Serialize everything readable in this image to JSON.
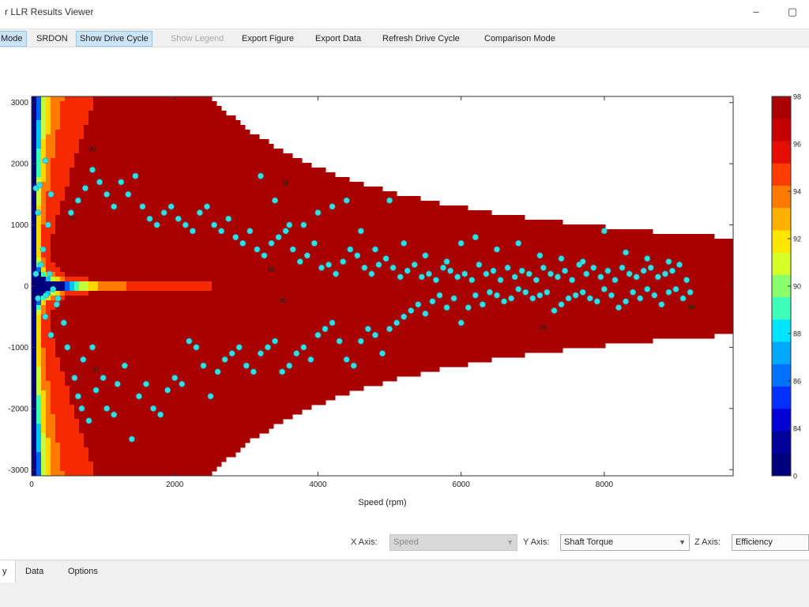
{
  "window": {
    "title": "r LLR Results Viewer",
    "minimize_glyph": "–",
    "close_glyph": "▢"
  },
  "toolbar": {
    "items": [
      {
        "label": "Mode",
        "state": "active"
      },
      {
        "label": "SRDON",
        "state": "normal"
      },
      {
        "label": "Show Drive Cycle",
        "state": "active"
      },
      {
        "label": "Show Legend",
        "state": "disabled"
      },
      {
        "label": "Export Figure",
        "state": "normal"
      },
      {
        "label": "Export Data",
        "state": "normal"
      },
      {
        "label": "Refresh Drive Cycle",
        "state": "normal"
      },
      {
        "label": "Comparison Mode",
        "state": "normal"
      }
    ]
  },
  "axis_selectors": {
    "x": {
      "label": "X Axis:",
      "value": "Speed",
      "enabled": false
    },
    "y": {
      "label": "Y Axis:",
      "value": "Shaft Torque",
      "enabled": true
    },
    "z": {
      "label": "Z Axis:",
      "value": "Efficiency",
      "enabled": true
    },
    "arrow_glyph": "▼"
  },
  "tabs": [
    {
      "label": "y",
      "active": true
    },
    {
      "label": "Data",
      "active": false
    },
    {
      "label": "Options",
      "active": false
    }
  ],
  "colors": {
    "out_of_envelope": "#ffffff",
    "contour_line": "#5a2a00",
    "scatter": "#2fe0e6",
    "scatter_edge": "#18a5b0"
  },
  "chart_data": {
    "type": "contour",
    "xlabel": "Speed (rpm)",
    "ylabel": "",
    "xlim": [
      0,
      9800
    ],
    "ylim": [
      -3100,
      3100
    ],
    "xticks": [
      0,
      2000,
      4000,
      6000,
      8000
    ],
    "yticks": [
      -3000,
      -2000,
      -1000,
      0,
      1000,
      2000,
      3000
    ],
    "xtick_labels": [
      "0",
      "2000",
      "4000",
      "6000",
      "8000"
    ],
    "ytick_labels": [
      "-3000",
      "-2000",
      "-1000",
      "0",
      "1000",
      "2000",
      "3000"
    ],
    "grid": false,
    "envelope": {
      "base_speed": 2500,
      "peak": 3100,
      "power_constant": 7750000,
      "min_limit": 700
    },
    "contour_levels": [
      0,
      84,
      86,
      88,
      90,
      92,
      94,
      96,
      98
    ],
    "contour_colors": [
      "#00007f",
      "#0000d8",
      "#005eff",
      "#00c2ff",
      "#3dffba",
      "#c2ff3d",
      "#ffd700",
      "#ff7b00",
      "#f52a00",
      "#a80000"
    ],
    "colorbar": {
      "levels": [
        "98",
        "96",
        "94",
        "92",
        "90",
        "88",
        "86",
        "84",
        "0"
      ],
      "colors": [
        "#a80000",
        "#c40000",
        "#e50d00",
        "#ff3b00",
        "#ff7b00",
        "#ffb000",
        "#ffe600",
        "#d6ff29",
        "#8aff6d",
        "#3dffba",
        "#00e5ff",
        "#00a8ff",
        "#0070ff",
        "#0030ff",
        "#0000d4",
        "#00009a",
        "#00007f"
      ]
    },
    "contour_labels": [
      {
        "text": "90",
        "x": 850,
        "y": 2200
      },
      {
        "text": "94",
        "x": 580,
        "y": 1070
      },
      {
        "text": "98",
        "x": 3550,
        "y": 1650
      },
      {
        "text": "96",
        "x": 3350,
        "y": 230
      },
      {
        "text": "96",
        "x": 3500,
        "y": -270
      },
      {
        "text": "92",
        "x": 900,
        "y": -1400
      },
      {
        "text": "98",
        "x": 7150,
        "y": -710
      },
      {
        "text": "96",
        "x": 9220,
        "y": -380
      }
    ],
    "drive_cycle": {
      "name": "Drive Cycle",
      "points": [
        [
          60,
          1600
        ],
        [
          110,
          1650
        ],
        [
          190,
          2050
        ],
        [
          270,
          1500
        ],
        [
          230,
          1000
        ],
        [
          90,
          1200
        ],
        [
          160,
          600
        ],
        [
          60,
          200
        ],
        [
          130,
          350
        ],
        [
          250,
          200
        ],
        [
          200,
          -150
        ],
        [
          90,
          -200
        ],
        [
          300,
          -50
        ],
        [
          350,
          -300
        ],
        [
          190,
          -500
        ],
        [
          270,
          -800
        ],
        [
          370,
          -200
        ],
        [
          450,
          -600
        ],
        [
          500,
          -1000
        ],
        [
          600,
          -1500
        ],
        [
          650,
          -1800
        ],
        [
          700,
          -2000
        ],
        [
          800,
          -2200
        ],
        [
          720,
          -1200
        ],
        [
          850,
          -1000
        ],
        [
          900,
          -1700
        ],
        [
          1000,
          -1500
        ],
        [
          1050,
          -2000
        ],
        [
          1150,
          -2100
        ],
        [
          1200,
          -1600
        ],
        [
          1300,
          -1300
        ],
        [
          1400,
          -2500
        ],
        [
          1500,
          -1800
        ],
        [
          1600,
          -1600
        ],
        [
          1700,
          -2000
        ],
        [
          1800,
          -2100
        ],
        [
          1900,
          -1700
        ],
        [
          2000,
          -1500
        ],
        [
          2100,
          -1600
        ],
        [
          2200,
          -900
        ],
        [
          2300,
          -1000
        ],
        [
          2400,
          -1300
        ],
        [
          2500,
          -1800
        ],
        [
          2600,
          -1400
        ],
        [
          2700,
          -1200
        ],
        [
          2800,
          -1100
        ],
        [
          2900,
          -1000
        ],
        [
          3000,
          -1300
        ],
        [
          3100,
          -1400
        ],
        [
          3200,
          -1100
        ],
        [
          3300,
          -1000
        ],
        [
          3400,
          -900
        ],
        [
          3500,
          -1400
        ],
        [
          3600,
          -1300
        ],
        [
          3700,
          -1100
        ],
        [
          3800,
          -1000
        ],
        [
          3900,
          -1200
        ],
        [
          4000,
          -800
        ],
        [
          4100,
          -700
        ],
        [
          4200,
          -600
        ],
        [
          4300,
          -900
        ],
        [
          4400,
          -1200
        ],
        [
          4500,
          -1300
        ],
        [
          4600,
          -900
        ],
        [
          4700,
          -700
        ],
        [
          4800,
          -800
        ],
        [
          4900,
          -1100
        ],
        [
          5000,
          -700
        ],
        [
          5100,
          -600
        ],
        [
          5200,
          -500
        ],
        [
          5300,
          -400
        ],
        [
          5400,
          -300
        ],
        [
          5500,
          -450
        ],
        [
          5600,
          -250
        ],
        [
          5700,
          -150
        ],
        [
          5800,
          -350
        ],
        [
          5900,
          -200
        ],
        [
          6000,
          -600
        ],
        [
          6100,
          -350
        ],
        [
          6200,
          -150
        ],
        [
          6300,
          -300
        ],
        [
          6400,
          -100
        ],
        [
          6500,
          -150
        ],
        [
          6600,
          -250
        ],
        [
          6700,
          -200
        ],
        [
          6800,
          -50
        ],
        [
          6900,
          -100
        ],
        [
          7000,
          -200
        ],
        [
          7100,
          -150
        ],
        [
          7200,
          -100
        ],
        [
          7300,
          -400
        ],
        [
          7400,
          -300
        ],
        [
          7500,
          -200
        ],
        [
          7600,
          -150
        ],
        [
          7700,
          -100
        ],
        [
          7800,
          -200
        ],
        [
          7900,
          -250
        ],
        [
          8000,
          -50
        ],
        [
          8100,
          -150
        ],
        [
          8200,
          -350
        ],
        [
          8300,
          -250
        ],
        [
          8400,
          -100
        ],
        [
          8500,
          -200
        ],
        [
          8600,
          -50
        ],
        [
          8700,
          -150
        ],
        [
          8800,
          -300
        ],
        [
          8900,
          -100
        ],
        [
          9000,
          -50
        ],
        [
          9100,
          -200
        ],
        [
          9200,
          -100
        ],
        [
          550,
          1200
        ],
        [
          650,
          1400
        ],
        [
          750,
          1600
        ],
        [
          850,
          1900
        ],
        [
          950,
          1700
        ],
        [
          1050,
          1500
        ],
        [
          1150,
          1300
        ],
        [
          1250,
          1700
        ],
        [
          1350,
          1500
        ],
        [
          1450,
          1800
        ],
        [
          1550,
          1300
        ],
        [
          1650,
          1100
        ],
        [
          1750,
          1000
        ],
        [
          1850,
          1200
        ],
        [
          1950,
          1300
        ],
        [
          2050,
          1100
        ],
        [
          2150,
          1000
        ],
        [
          2250,
          900
        ],
        [
          2350,
          1200
        ],
        [
          2450,
          1300
        ],
        [
          2550,
          1000
        ],
        [
          2650,
          900
        ],
        [
          2750,
          1100
        ],
        [
          2850,
          800
        ],
        [
          2950,
          700
        ],
        [
          3050,
          900
        ],
        [
          3150,
          600
        ],
        [
          3250,
          500
        ],
        [
          3350,
          700
        ],
        [
          3450,
          800
        ],
        [
          3550,
          900
        ],
        [
          3650,
          600
        ],
        [
          3750,
          400
        ],
        [
          3850,
          500
        ],
        [
          3950,
          700
        ],
        [
          4050,
          300
        ],
        [
          4150,
          350
        ],
        [
          4250,
          200
        ],
        [
          4350,
          400
        ],
        [
          4450,
          600
        ],
        [
          4550,
          500
        ],
        [
          4650,
          300
        ],
        [
          4750,
          200
        ],
        [
          4850,
          350
        ],
        [
          4950,
          450
        ],
        [
          5050,
          300
        ],
        [
          5150,
          150
        ],
        [
          5250,
          250
        ],
        [
          5350,
          350
        ],
        [
          5450,
          150
        ],
        [
          5550,
          200
        ],
        [
          5650,
          100
        ],
        [
          5750,
          300
        ],
        [
          5850,
          250
        ],
        [
          5950,
          150
        ],
        [
          6050,
          200
        ],
        [
          6150,
          100
        ],
        [
          6250,
          350
        ],
        [
          6350,
          200
        ],
        [
          6450,
          250
        ],
        [
          6550,
          100
        ],
        [
          6650,
          300
        ],
        [
          6750,
          150
        ],
        [
          6850,
          250
        ],
        [
          6950,
          200
        ],
        [
          7050,
          100
        ],
        [
          7150,
          300
        ],
        [
          7250,
          200
        ],
        [
          7350,
          150
        ],
        [
          7450,
          250
        ],
        [
          7550,
          100
        ],
        [
          7650,
          350
        ],
        [
          7750,
          200
        ],
        [
          7850,
          300
        ],
        [
          7950,
          150
        ],
        [
          8050,
          250
        ],
        [
          8150,
          100
        ],
        [
          8250,
          300
        ],
        [
          8350,
          200
        ],
        [
          8450,
          150
        ],
        [
          8550,
          250
        ],
        [
          8650,
          300
        ],
        [
          8750,
          150
        ],
        [
          8850,
          200
        ],
        [
          8950,
          250
        ],
        [
          9050,
          350
        ],
        [
          9150,
          100
        ],
        [
          3200,
          1800
        ],
        [
          3400,
          1400
        ],
        [
          3600,
          1000
        ],
        [
          3800,
          1000
        ],
        [
          4000,
          1200
        ],
        [
          4200,
          1300
        ],
        [
          4400,
          1400
        ],
        [
          4600,
          900
        ],
        [
          4800,
          600
        ],
        [
          5000,
          1400
        ],
        [
          5200,
          700
        ],
        [
          5500,
          500
        ],
        [
          5800,
          400
        ],
        [
          6000,
          700
        ],
        [
          6200,
          800
        ],
        [
          6500,
          600
        ],
        [
          6800,
          700
        ],
        [
          7100,
          500
        ],
        [
          7400,
          450
        ],
        [
          7700,
          400
        ],
        [
          8000,
          900
        ],
        [
          8300,
          550
        ],
        [
          8600,
          450
        ],
        [
          8900,
          400
        ]
      ]
    }
  }
}
